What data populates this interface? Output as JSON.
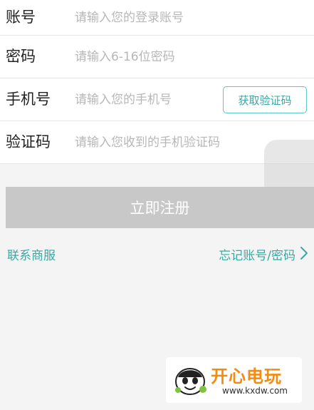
{
  "form": {
    "account": {
      "label": "账号",
      "placeholder": "请输入您的登录账号"
    },
    "password": {
      "label": "密码",
      "placeholder": "请输入6-16位密码"
    },
    "phone": {
      "label": "手机号",
      "placeholder": "请输入您的手机号",
      "code_button_label": "获取验证码"
    },
    "verification": {
      "label": "验证码",
      "placeholder": "请输入您收到的手机验证码"
    }
  },
  "actions": {
    "register_label": "立即注册",
    "contact_support_label": "联系商服",
    "forgot_label": "忘记账号/密码"
  },
  "watermark": {
    "title": "开心电玩",
    "url": "www.kxdw.com"
  },
  "colors": {
    "accent": "#3aa8a3",
    "register_disabled": "#c8c8c8",
    "watermark_orange": "#f28b11"
  },
  "icons": {
    "forgot_arrow": "chevron-right-icon",
    "watermark_logo": "mascot-logo-icon"
  }
}
